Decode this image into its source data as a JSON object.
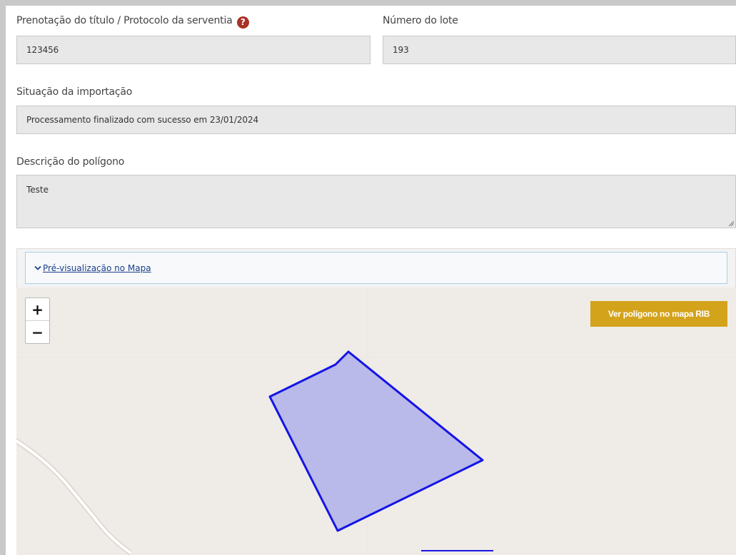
{
  "form": {
    "protocol_label": "Prenotação do título / Protocolo da serventia",
    "protocol_value": "123456",
    "lot_label": "Número do lote",
    "lot_value": "193",
    "status_label": "Situação da importação",
    "status_value": "Processamento finalizado com sucesso em 23/01/2024",
    "description_label": "Descrição do polígono",
    "description_value": "Teste"
  },
  "preview": {
    "toggle_label": "Pré-visualização no Mapa",
    "rib_button_label": "Ver polígono no mapa RIB",
    "zoom_in": "+",
    "zoom_out": "−"
  },
  "icons": {
    "help": "question-circle-icon",
    "toggle": "chevron-down-icon"
  },
  "colors": {
    "polygon_stroke": "#1414e6",
    "polygon_fill": "#b9b9ea",
    "rib_button": "#d4a31c",
    "help_icon": "#a83226",
    "link": "#1a3e8c"
  }
}
